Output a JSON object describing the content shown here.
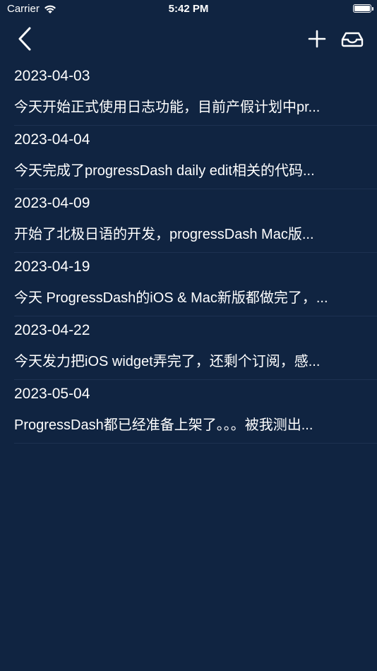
{
  "status_bar": {
    "carrier": "Carrier",
    "time": "5:42 PM"
  },
  "nav": {
    "back_icon": "chevron-left-icon",
    "add_icon": "plus-icon",
    "inbox_icon": "tray-icon"
  },
  "entries": [
    {
      "date": "2023-04-03",
      "text": "今天开始正式使用日志功能，目前产假计划中pr..."
    },
    {
      "date": "2023-04-04",
      "text": "今天完成了progressDash daily edit相关的代码..."
    },
    {
      "date": "2023-04-09",
      "text": "开始了北极日语的开发，progressDash Mac版..."
    },
    {
      "date": "2023-04-19",
      "text": "今天 ProgressDash的iOS & Mac新版都做完了，..."
    },
    {
      "date": "2023-04-22",
      "text": "今天发力把iOS widget弄完了，还剩个订阅，感..."
    },
    {
      "date": "2023-05-04",
      "text": "ProgressDash都已经准备上架了。。。被我测出..."
    }
  ],
  "colors": {
    "background": "#102441",
    "separator": "#1d3151",
    "text": "#ffffff"
  }
}
